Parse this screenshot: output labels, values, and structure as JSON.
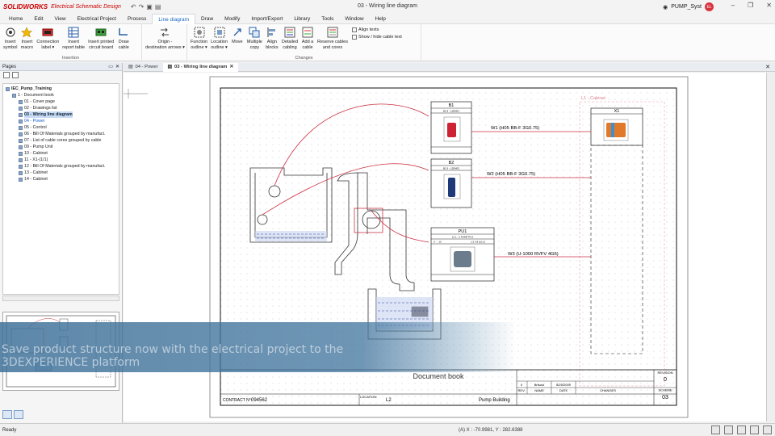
{
  "app": {
    "logo": "SOLIDWORKS",
    "product": "Electrical Schematic Design",
    "doc_title": "03 - Wiring line diagram",
    "user": "PUMP_Syst",
    "user_initials": "EL"
  },
  "menu": [
    "Home",
    "Edit",
    "View",
    "Electrical Project",
    "Process",
    "Line diagram",
    "Draw",
    "Modify",
    "Import/Export",
    "Library",
    "Tools",
    "Window",
    "Help"
  ],
  "menu_active": "Line diagram",
  "ribbon": {
    "insertion": {
      "title": "Insertion",
      "buttons": [
        "Insert\nsymbol",
        "Insert\nmacro",
        "Connection\nlabel ▾",
        "Insert\nreport table",
        "Insert printed\ncircuit board",
        "Draw\ncable"
      ]
    },
    "origin": {
      "buttons": [
        "Origin -\ndestination arrows ▾"
      ]
    },
    "changes": {
      "title": "Changes",
      "buttons": [
        "Function\noutline ▾",
        "Location\noutline ▾",
        "Move",
        "Multiple\ncopy",
        "Align\nblocks",
        "Detailed\ncabling",
        "Add a\ncable",
        "Reserve cables\nand cores"
      ],
      "small": [
        "Align texts",
        "Show / hide cable text"
      ]
    }
  },
  "pages_panel": {
    "title": "Pages",
    "tree": [
      {
        "label": "IEC_Pump_Training",
        "level": 0,
        "type": "root"
      },
      {
        "label": "1 - Document book",
        "level": 1,
        "type": "book"
      },
      {
        "label": "01 - Cover page",
        "level": 2
      },
      {
        "label": "02 - Drawings list",
        "level": 2
      },
      {
        "label": "03 - Wiring line diagram",
        "level": 2,
        "selected": true
      },
      {
        "label": "04 - Power",
        "level": 2,
        "blue": true
      },
      {
        "label": "05 - Control",
        "level": 2
      },
      {
        "label": "06 - Bill Of Materials grouped by manufact.",
        "level": 2
      },
      {
        "label": "07 - List of cable cores grouped by cable",
        "level": 2
      },
      {
        "label": "09 - Pump Unit",
        "level": 2
      },
      {
        "label": "10 - Cabinet",
        "level": 2
      },
      {
        "label": "11 - X1-(1/1)",
        "level": 2
      },
      {
        "label": "12 - Bill Of Materials grouped by manufact.",
        "level": 2
      },
      {
        "label": "13 - Cabinet",
        "level": 2
      },
      {
        "label": "14 - Cabinet",
        "level": 2
      }
    ]
  },
  "doc_tabs": [
    {
      "label": "04 - Power",
      "active": false
    },
    {
      "label": "03 - Wiring line diagram",
      "active": true
    }
  ],
  "drawing": {
    "components": [
      {
        "ref": "B1",
        "sub": "B1.8 - L2EM01"
      },
      {
        "ref": "B2",
        "sub": "B1.9 - L2EM02"
      },
      {
        "ref": "PU1",
        "sub": "L2.1 - 2 PUMP PU1"
      },
      {
        "ref": "X1",
        "sub": ""
      }
    ],
    "pu1_row": [
      "0 → 10",
      "1 5 3 8 (10.2)"
    ],
    "cables": [
      "W1 (H05 BB-F 3G0.75)",
      "W2 (H05 BB-F 3G0.75)",
      "W3 (U-1000 RVFV 4G6)"
    ],
    "cabinet_label": "L1 - Cabinet",
    "title_block": {
      "title": "Document book",
      "contract_label": "CONTRACT N°:",
      "contract": "094562",
      "location_label": "LOCATION:",
      "location": "L2",
      "building": "Pump Building",
      "revision_row": [
        "0",
        "Brtsuio",
        "8/25/2009"
      ],
      "revision_headers": [
        "REV.",
        "NAME",
        "DATE",
        "CHANGES"
      ],
      "revision_label": "REVISION",
      "revision": "0",
      "scheme_label": "SCHEME",
      "scheme": "03"
    }
  },
  "banner": {
    "text": "Save product structure now with the electrical project to the 3DEXPERIENCE platform"
  },
  "status": {
    "text": "Ready",
    "coords": "(A) X : -70.9981, Y : 282.6388"
  },
  "colors": {
    "accent": "#1565c0",
    "brand": "#cc0000",
    "cable_line": "#cc3344",
    "banner": "#3a6d96"
  }
}
